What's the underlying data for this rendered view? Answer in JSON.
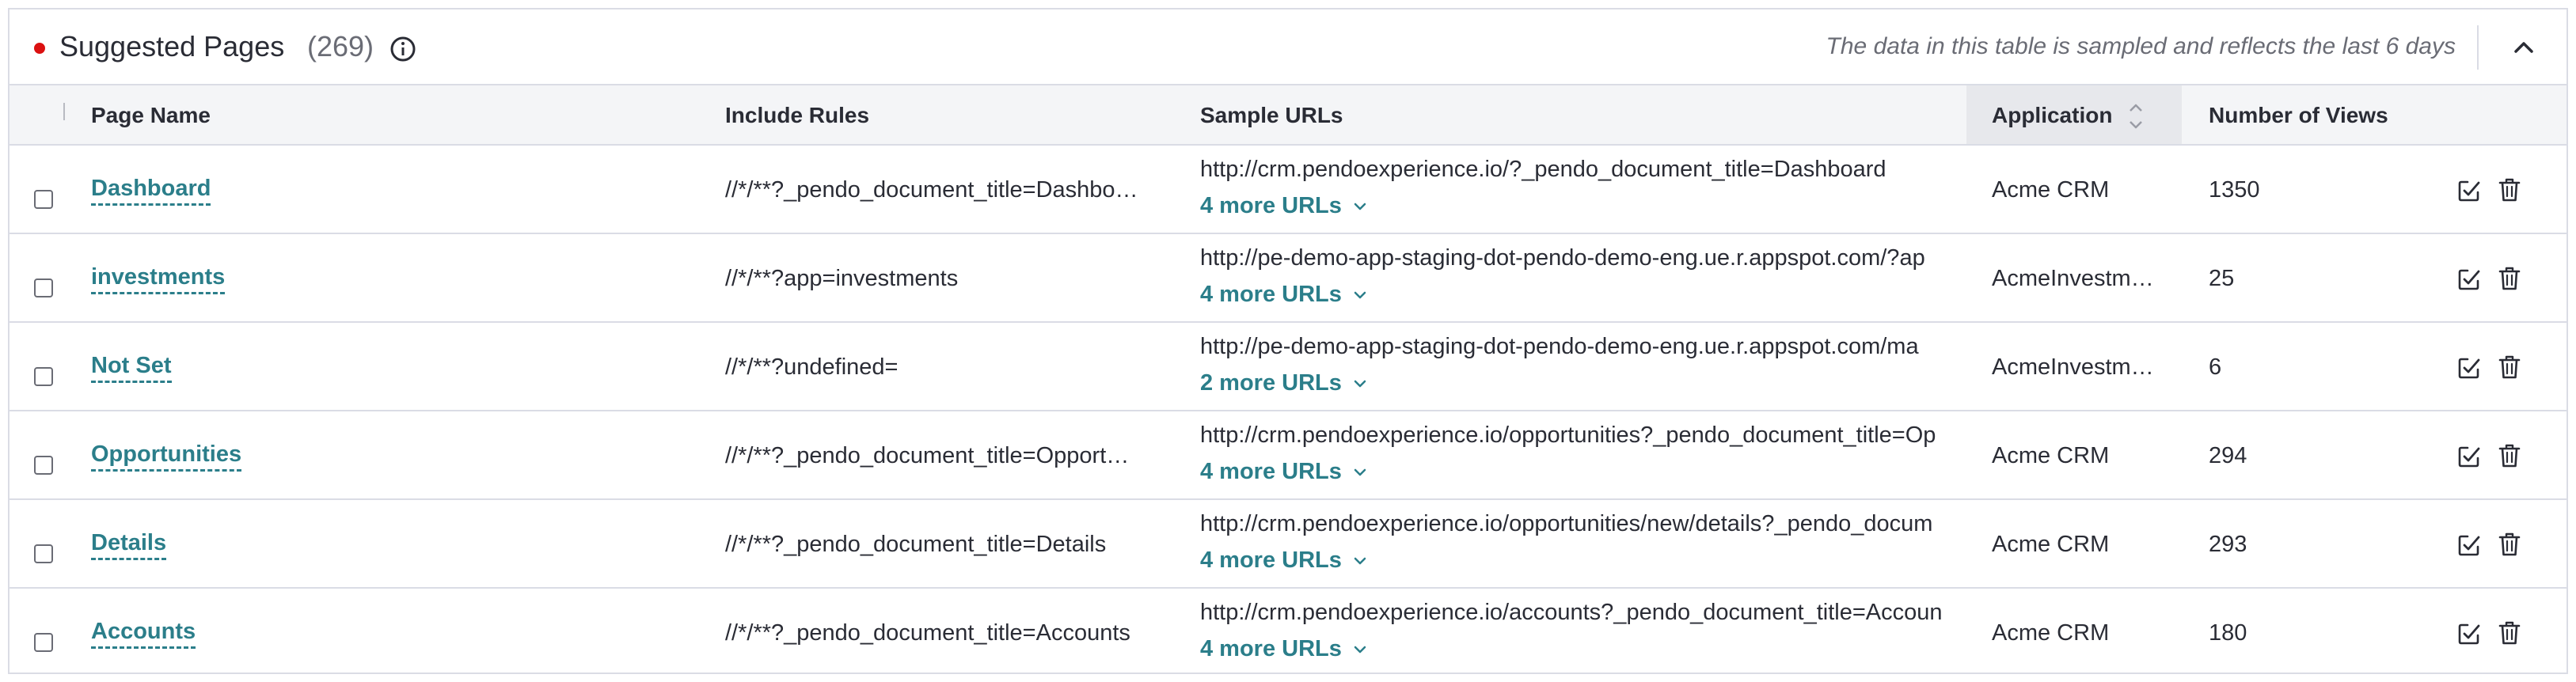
{
  "header": {
    "title": "Suggested Pages",
    "count": "(269)",
    "sample_note": "The data in this table is sampled and reflects the last 6 days",
    "status_color": "#db1111"
  },
  "columns": {
    "page_name": "Page Name",
    "include_rules": "Include Rules",
    "sample_urls": "Sample URLs",
    "application": "Application",
    "number_of_views": "Number of Views"
  },
  "accent_color": "#2b7e8a",
  "rows": [
    {
      "page_name": "Dashboard",
      "include_rule": "//*/**?_pendo_document_title=Dashbo…",
      "sample_url": "http://crm.pendoexperience.io/?_pendo_document_title=Dashboard",
      "more_urls": "4 more URLs",
      "application": "Acme CRM",
      "views": "1350"
    },
    {
      "page_name": "investments",
      "include_rule": "//*/**?app=investments",
      "sample_url": "http://pe-demo-app-staging-dot-pendo-demo-eng.ue.r.appspot.com/?ap",
      "more_urls": "4 more URLs",
      "application": "AcmeInvestm…",
      "views": "25"
    },
    {
      "page_name": "Not Set",
      "include_rule": "//*/**?undefined=",
      "sample_url": "http://pe-demo-app-staging-dot-pendo-demo-eng.ue.r.appspot.com/ma",
      "more_urls": "2 more URLs",
      "application": "AcmeInvestm…",
      "views": "6"
    },
    {
      "page_name": "Opportunities",
      "include_rule": "//*/**?_pendo_document_title=Opport…",
      "sample_url": "http://crm.pendoexperience.io/opportunities?_pendo_document_title=Op",
      "more_urls": "4 more URLs",
      "application": "Acme CRM",
      "views": "294"
    },
    {
      "page_name": "Details",
      "include_rule": "//*/**?_pendo_document_title=Details",
      "sample_url": "http://crm.pendoexperience.io/opportunities/new/details?_pendo_docum",
      "more_urls": "4 more URLs",
      "application": "Acme CRM",
      "views": "293"
    },
    {
      "page_name": "Accounts",
      "include_rule": "//*/**?_pendo_document_title=Accounts",
      "sample_url": "http://crm.pendoexperience.io/accounts?_pendo_document_title=Accoun",
      "more_urls": "4 more URLs",
      "application": "Acme CRM",
      "views": "180"
    }
  ]
}
